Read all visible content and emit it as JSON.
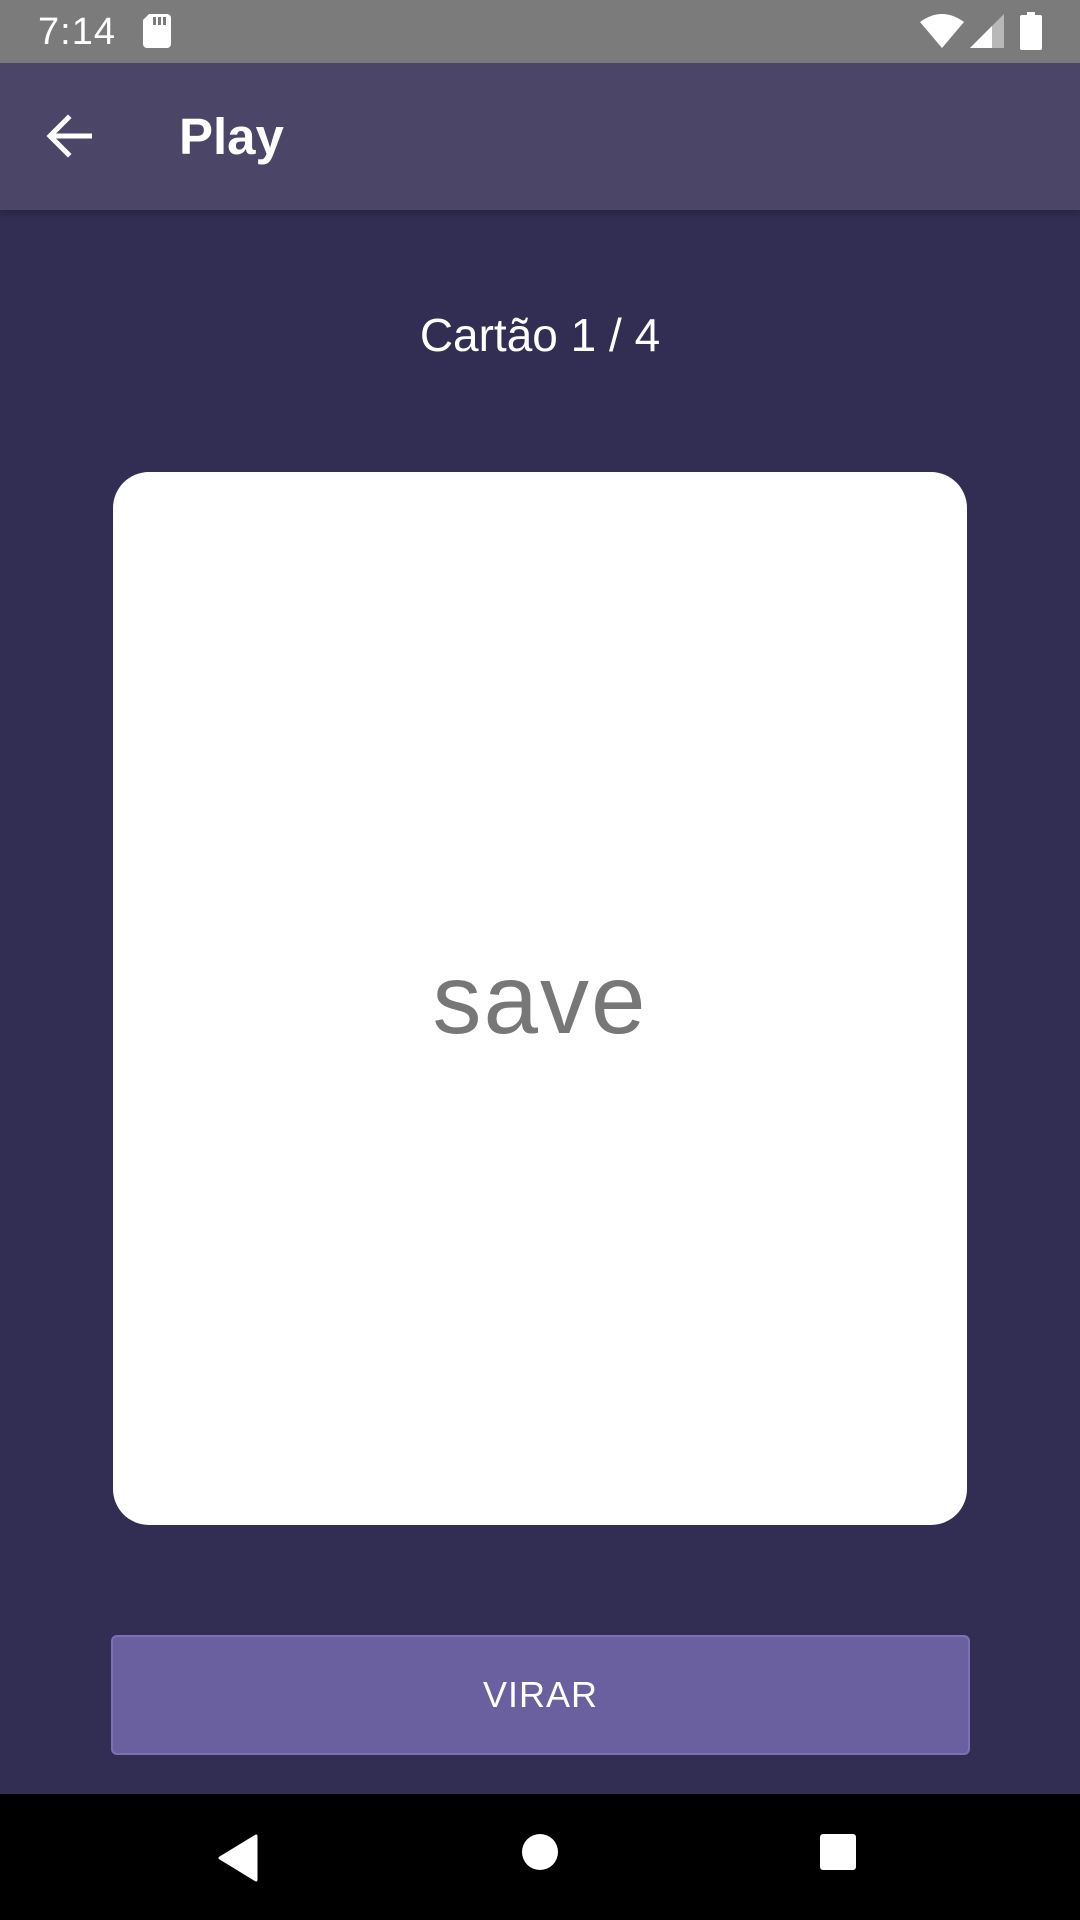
{
  "status_bar": {
    "time": "7:14",
    "icons": [
      "sd-card-icon",
      "wifi-icon",
      "signal-icon",
      "battery-icon"
    ]
  },
  "app_bar": {
    "title": "Play",
    "back_icon": "arrow-back-icon"
  },
  "counter": {
    "text": "Cartão 1 / 4"
  },
  "card": {
    "word": "save"
  },
  "flip_button": {
    "label": "VIRAR"
  },
  "nav_bar": {
    "icons": [
      "nav-back-icon",
      "nav-home-icon",
      "nav-recents-icon"
    ]
  },
  "colors": {
    "background": "#322d52",
    "app_bar": "#4b4568",
    "status_bar": "#7b7b7b",
    "button": "#6a60a0",
    "card": "#ffffff",
    "card_text": "#777777"
  }
}
